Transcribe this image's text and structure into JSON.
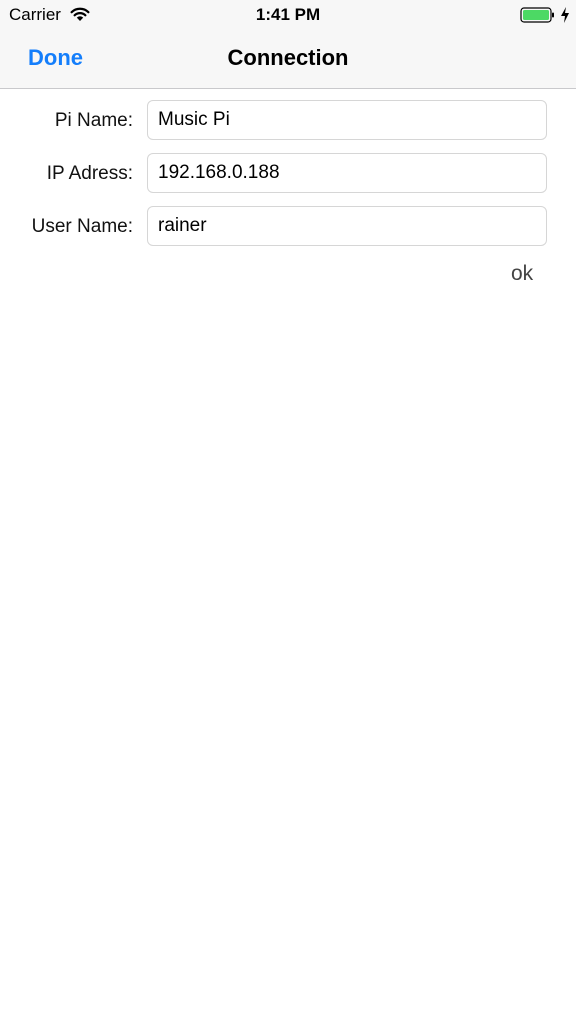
{
  "status_bar": {
    "carrier": "Carrier",
    "time": "1:41 PM",
    "wifi_icon": "wifi-icon",
    "battery_icon": "battery-icon",
    "charging_icon": "charging-bolt-icon",
    "battery_color": "#4cd964"
  },
  "nav": {
    "done_label": "Done",
    "title": "Connection",
    "accent_color": "#147efb"
  },
  "form": {
    "pi_name_label": "Pi Name:",
    "pi_name_value": "Music Pi",
    "ip_label": "IP Adress:",
    "ip_value": "192.168.0.188",
    "user_label": "User Name:",
    "user_value": "rainer",
    "ok_label": "ok"
  }
}
